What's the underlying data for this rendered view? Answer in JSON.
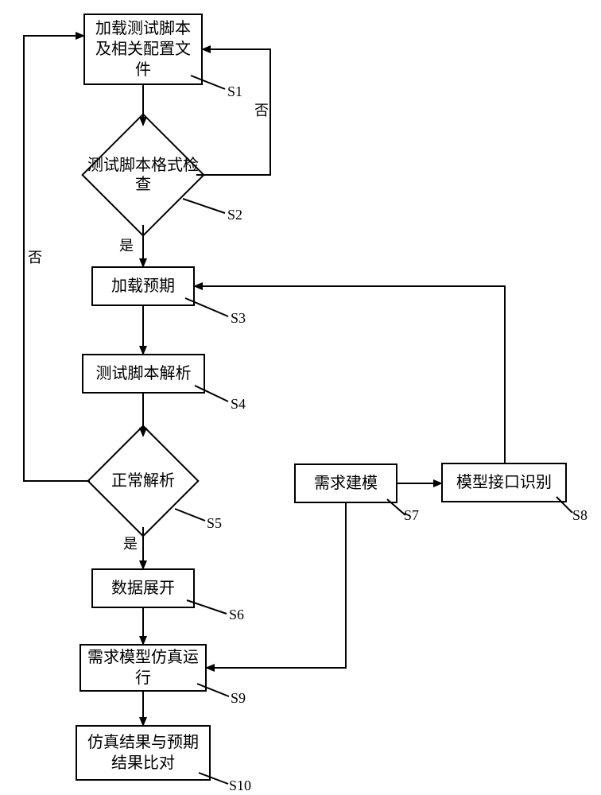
{
  "nodes": {
    "s1": "加载测试脚本及相关配置文件",
    "s2": "测试脚本格式检查",
    "s3": "加载预期",
    "s4": "测试脚本解析",
    "s5": "正常解析",
    "s6": "数据展开",
    "s7": "需求建模",
    "s8": "模型接口识别",
    "s9": "需求模型仿真运行",
    "s10": "仿真结果与预期结果比对"
  },
  "tags": {
    "s1": "S1",
    "s2": "S2",
    "s3": "S3",
    "s4": "S4",
    "s5": "S5",
    "s6": "S6",
    "s7": "S7",
    "s8": "S8",
    "s9": "S9",
    "s10": "S10"
  },
  "edges": {
    "yes": "是",
    "no": "否"
  }
}
